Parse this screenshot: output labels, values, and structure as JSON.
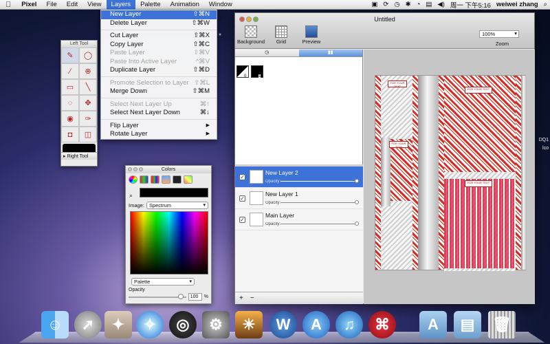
{
  "menubar": {
    "apple": "",
    "app": "Pixel",
    "items": [
      "File",
      "Edit",
      "View",
      "Layers",
      "Palette",
      "Animation",
      "Window"
    ],
    "clock": "周一 下午5:16",
    "user": "weiwei zhang"
  },
  "layers_menu": {
    "items": [
      {
        "label": "New Layer",
        "shortcut": "⇧⌘N",
        "state": "highlighted"
      },
      {
        "label": "Delete Layer",
        "shortcut": "⇧⌘W",
        "state": "enabled"
      },
      {
        "label": "Cut Layer",
        "shortcut": "⇧⌘X",
        "state": "enabled"
      },
      {
        "label": "Copy Layer",
        "shortcut": "⇧⌘C",
        "state": "enabled"
      },
      {
        "label": "Paste Layer",
        "shortcut": "⇧⌘V",
        "state": "disabled"
      },
      {
        "label": "Paste Into Active Layer",
        "shortcut": "^⌘V",
        "state": "disabled"
      },
      {
        "label": "Duplicate Layer",
        "shortcut": "⇧⌘D",
        "state": "enabled"
      },
      {
        "label": "Promote Selection to Layer",
        "shortcut": "⇧⌘L",
        "state": "disabled"
      },
      {
        "label": "Merge Down",
        "shortcut": "⇧⌘M",
        "state": "enabled"
      },
      {
        "label": "Select Next Layer Up",
        "shortcut": "⌘↑",
        "state": "disabled"
      },
      {
        "label": "Select Next Layer Down",
        "shortcut": "⌘↓",
        "state": "enabled"
      },
      {
        "label": "Flip Layer",
        "shortcut": "▶",
        "state": "enabled"
      },
      {
        "label": "Rotate Layer",
        "shortcut": "▶",
        "state": "enabled"
      }
    ]
  },
  "left_tool": {
    "title": "Left Tool",
    "right_tool_label": "Right Tool"
  },
  "colors_panel": {
    "title": "Colors",
    "image_label": "Image:",
    "image_value": "Spectrum",
    "palette_value": "Palette",
    "opacity_label": "Opacity",
    "opacity_value": "100",
    "opacity_unit": "%"
  },
  "main_window": {
    "title": "Untitled",
    "toolbar": [
      "Background",
      "Grid",
      "Preview"
    ],
    "zoom_value": "100%",
    "zoom_label": "Zoom",
    "layers": [
      {
        "name": "New Layer 2",
        "opacity_label": "Opacity:",
        "selected": true
      },
      {
        "name": "New Layer 1",
        "opacity_label": "Opacity:",
        "selected": false
      },
      {
        "name": "Main Layer",
        "opacity_label": "Opacity:",
        "selected": false
      }
    ],
    "add_label": "+",
    "remove_label": "−",
    "frames": [
      "0",
      "1"
    ]
  },
  "artwork_labels": [
    "FOR YOUR TEXT",
    "FOR YOUR TEXT",
    "FOR YOUR TEXT",
    "FOR YOUR TEXT"
  ],
  "dock": [
    "Finder",
    "Launchpad",
    "Preview",
    "Safari",
    "Dashboard",
    "System Preferences",
    "iPhoto",
    "Word",
    "App Store",
    "iTunes",
    "Acrobat",
    "Applications",
    "Documents",
    "Trash"
  ],
  "edge_text": [
    "DQ1",
    "lco"
  ]
}
